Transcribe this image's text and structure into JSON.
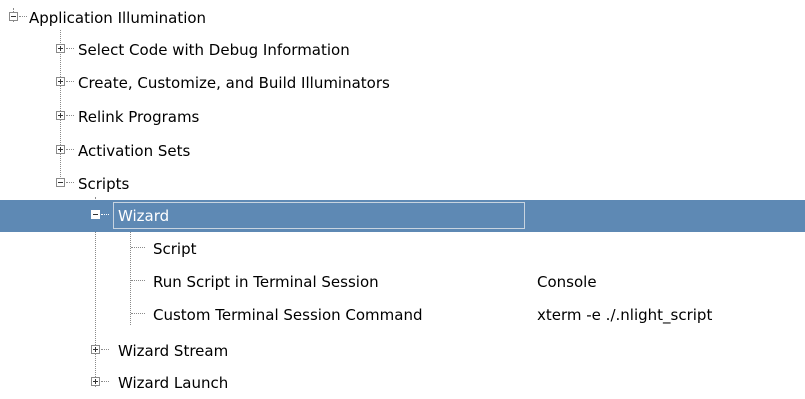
{
  "tree": {
    "root": {
      "label": "Application Illumination",
      "expanded": true
    },
    "children": [
      {
        "label": "Select Code with Debug Information",
        "expanded": false
      },
      {
        "label": "Create, Customize, and Build Illuminators",
        "expanded": false
      },
      {
        "label": "Relink Programs",
        "expanded": false
      },
      {
        "label": "Activation Sets",
        "expanded": false
      },
      {
        "label": "Scripts",
        "expanded": true
      }
    ],
    "wizard": {
      "label": "Wizard",
      "expanded": true,
      "selected": true
    },
    "wizard_children": [
      {
        "label": "Script",
        "value": ""
      },
      {
        "label": "Run Script in Terminal Session",
        "value": "Console"
      },
      {
        "label": "Custom Terminal Session Command",
        "value": "xterm -e ./.nlight_script"
      }
    ],
    "scripts_more": [
      {
        "label": "Wizard Stream",
        "expanded": false
      },
      {
        "label": "Wizard Launch",
        "expanded": false
      }
    ]
  },
  "colors": {
    "selection": "#5e89b4",
    "text": "#000000",
    "selected_text": "#ffffff"
  }
}
